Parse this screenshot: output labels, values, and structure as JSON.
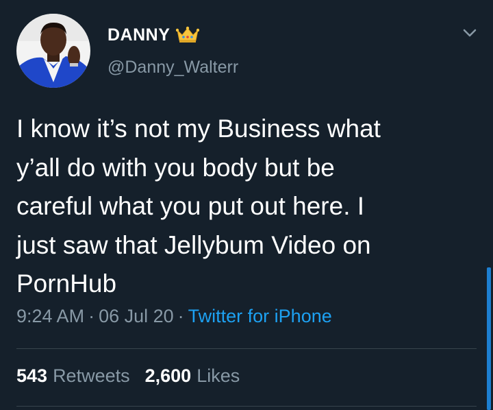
{
  "tweet": {
    "display_name": "DANNY",
    "handle": "@Danny_Walterr",
    "text": "I know it’s not my Business what\ny’all do with you body but be\ncareful what you put out here. I\njust saw that Jellybum Video on\nPornHub",
    "time": "9:24 AM",
    "separator": "·",
    "date": "06 Jul 20",
    "source": "Twitter for iPhone",
    "retweets_count": "543",
    "retweets_label": "Retweets",
    "likes_count": "2,600",
    "likes_label": "Likes"
  },
  "icons": {
    "verified_badge": "crown-emoji",
    "menu": "chevron-down-icon"
  },
  "colors": {
    "background": "#15202b",
    "primary_text": "#ffffff",
    "secondary_text": "#8899a6",
    "link": "#1da1f2",
    "divider": "#38444d"
  }
}
